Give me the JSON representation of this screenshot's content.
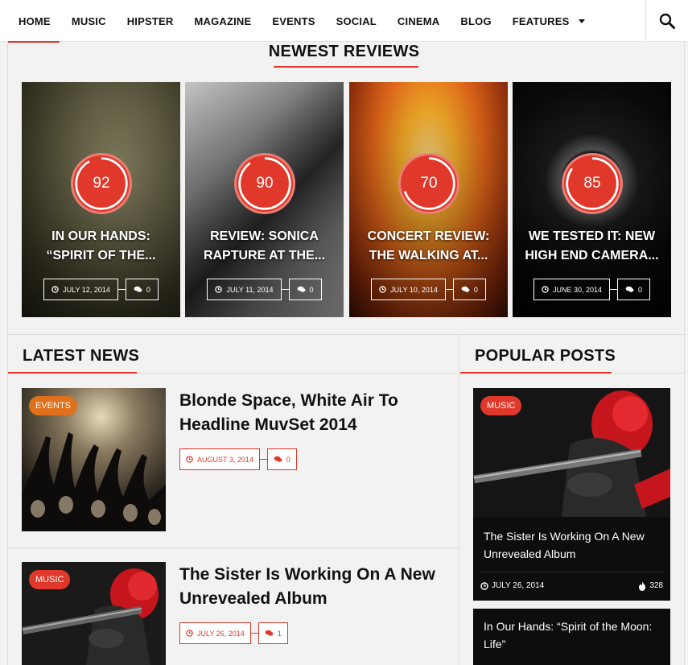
{
  "nav": {
    "items": [
      "HOME",
      "MUSIC",
      "HIPSTER",
      "MAGAZINE",
      "EVENTS",
      "SOCIAL",
      "CINEMA",
      "BLOG",
      "FEATURES"
    ]
  },
  "sections": {
    "newest_reviews": "NEWEST REVIEWS",
    "latest_news": "LATEST NEWS",
    "popular_posts": "POPULAR POSTS"
  },
  "reviews": [
    {
      "score": "92",
      "score_pct": 0.92,
      "title": "IN OUR HANDS: “SPIRIT OF THE...",
      "date": "JULY 12, 2014",
      "comments": "0"
    },
    {
      "score": "90",
      "score_pct": 0.9,
      "title": "REVIEW: SONICA RAPTURE AT THE...",
      "date": "JULY 11, 2014",
      "comments": "0"
    },
    {
      "score": "70",
      "score_pct": 0.7,
      "title": "CONCERT REVIEW: THE WALKING AT...",
      "date": "JULY 10, 2014",
      "comments": "0"
    },
    {
      "score": "85",
      "score_pct": 0.85,
      "title": "WE TESTED IT: NEW HIGH END CAMERA...",
      "date": "JUNE 30, 2014",
      "comments": "0"
    }
  ],
  "latest_news": [
    {
      "badge": "EVENTS",
      "badge_color": "#e0701c",
      "title": "Blonde Space, White Air To Headline MuvSet 2014",
      "date": "AUGUST 3, 2014",
      "comments": "0"
    },
    {
      "badge": "MUSIC",
      "badge_color": "#e0392b",
      "title": "The Sister Is Working On A New Unrevealed Album",
      "date": "JULY 26, 2014",
      "comments": "1"
    }
  ],
  "popular_posts": [
    {
      "badge": "MUSIC",
      "title": "The Sister Is Working On A New Unrevealed Album",
      "date": "JULY 26, 2014",
      "views": "328"
    },
    {
      "title": "In Our Hands: “Spirit of the Moon: Life”"
    }
  ],
  "colors": {
    "accent": "#e0392b",
    "events_badge": "#e0701c"
  }
}
